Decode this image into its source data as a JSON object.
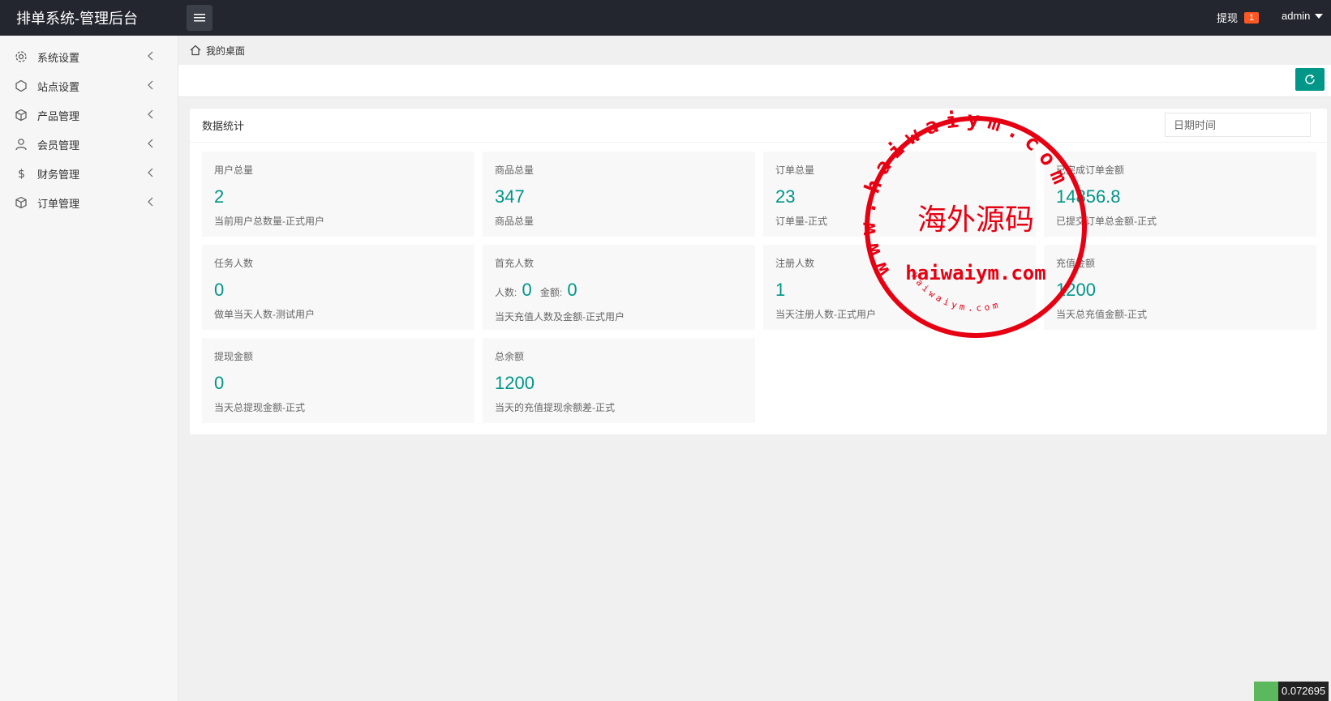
{
  "header": {
    "title": "排单系统-管理后台",
    "withdraw_label": "提现",
    "withdraw_badge": "1",
    "user_name": "admin"
  },
  "sidebar": {
    "items": [
      {
        "label": "系统设置",
        "icon": "gear-icon"
      },
      {
        "label": "站点设置",
        "icon": "site-icon"
      },
      {
        "label": "产品管理",
        "icon": "box-icon"
      },
      {
        "label": "会员管理",
        "icon": "user-icon"
      },
      {
        "label": "财务管理",
        "icon": "dollar-icon"
      },
      {
        "label": "订单管理",
        "icon": "order-icon"
      }
    ]
  },
  "breadcrumb": {
    "home_label": "我的桌面"
  },
  "panel": {
    "title": "数据统计",
    "date_placeholder": "日期时间"
  },
  "cards": [
    {
      "label": "用户总量",
      "value": "2",
      "desc": "当前用户总数量-正式用户"
    },
    {
      "label": "商品总量",
      "value": "347",
      "desc": "商品总量"
    },
    {
      "label": "订单总量",
      "value": "23",
      "desc": "订单量-正式"
    },
    {
      "label": "已完成订单金额",
      "value": "14856.8",
      "desc": "已提交订单总金额-正式"
    },
    {
      "label": "任务人数",
      "value": "0",
      "desc": "做单当天人数-测试用户"
    },
    {
      "label": "首充人数",
      "count_label": "人数:",
      "count_value": "0",
      "amount_label": "金额:",
      "amount_value": "0",
      "desc": "当天充值人数及金额-正式用户"
    },
    {
      "label": "注册人数",
      "value": "1",
      "desc": "当天注册人数-正式用户"
    },
    {
      "label": "充值金额",
      "value": "1200",
      "desc": "当天总充值金额-正式"
    },
    {
      "label": "提现金额",
      "value": "0",
      "desc": "当天总提现金额-正式"
    },
    {
      "label": "总余额",
      "value": "1200",
      "desc": "当天的充值提现余额差-正式"
    }
  ],
  "watermark": {
    "ring_text": "www.haiwaiym.com",
    "center_text": "海外源码",
    "domain_text": "haiwaiym.com",
    "small_text": "haiwaiym.com"
  },
  "corner": {
    "value": "0.072695"
  },
  "colors": {
    "accent": "#009688",
    "topbar": "#23262e",
    "badge": "#ff5722",
    "stamp": "#e60012"
  }
}
